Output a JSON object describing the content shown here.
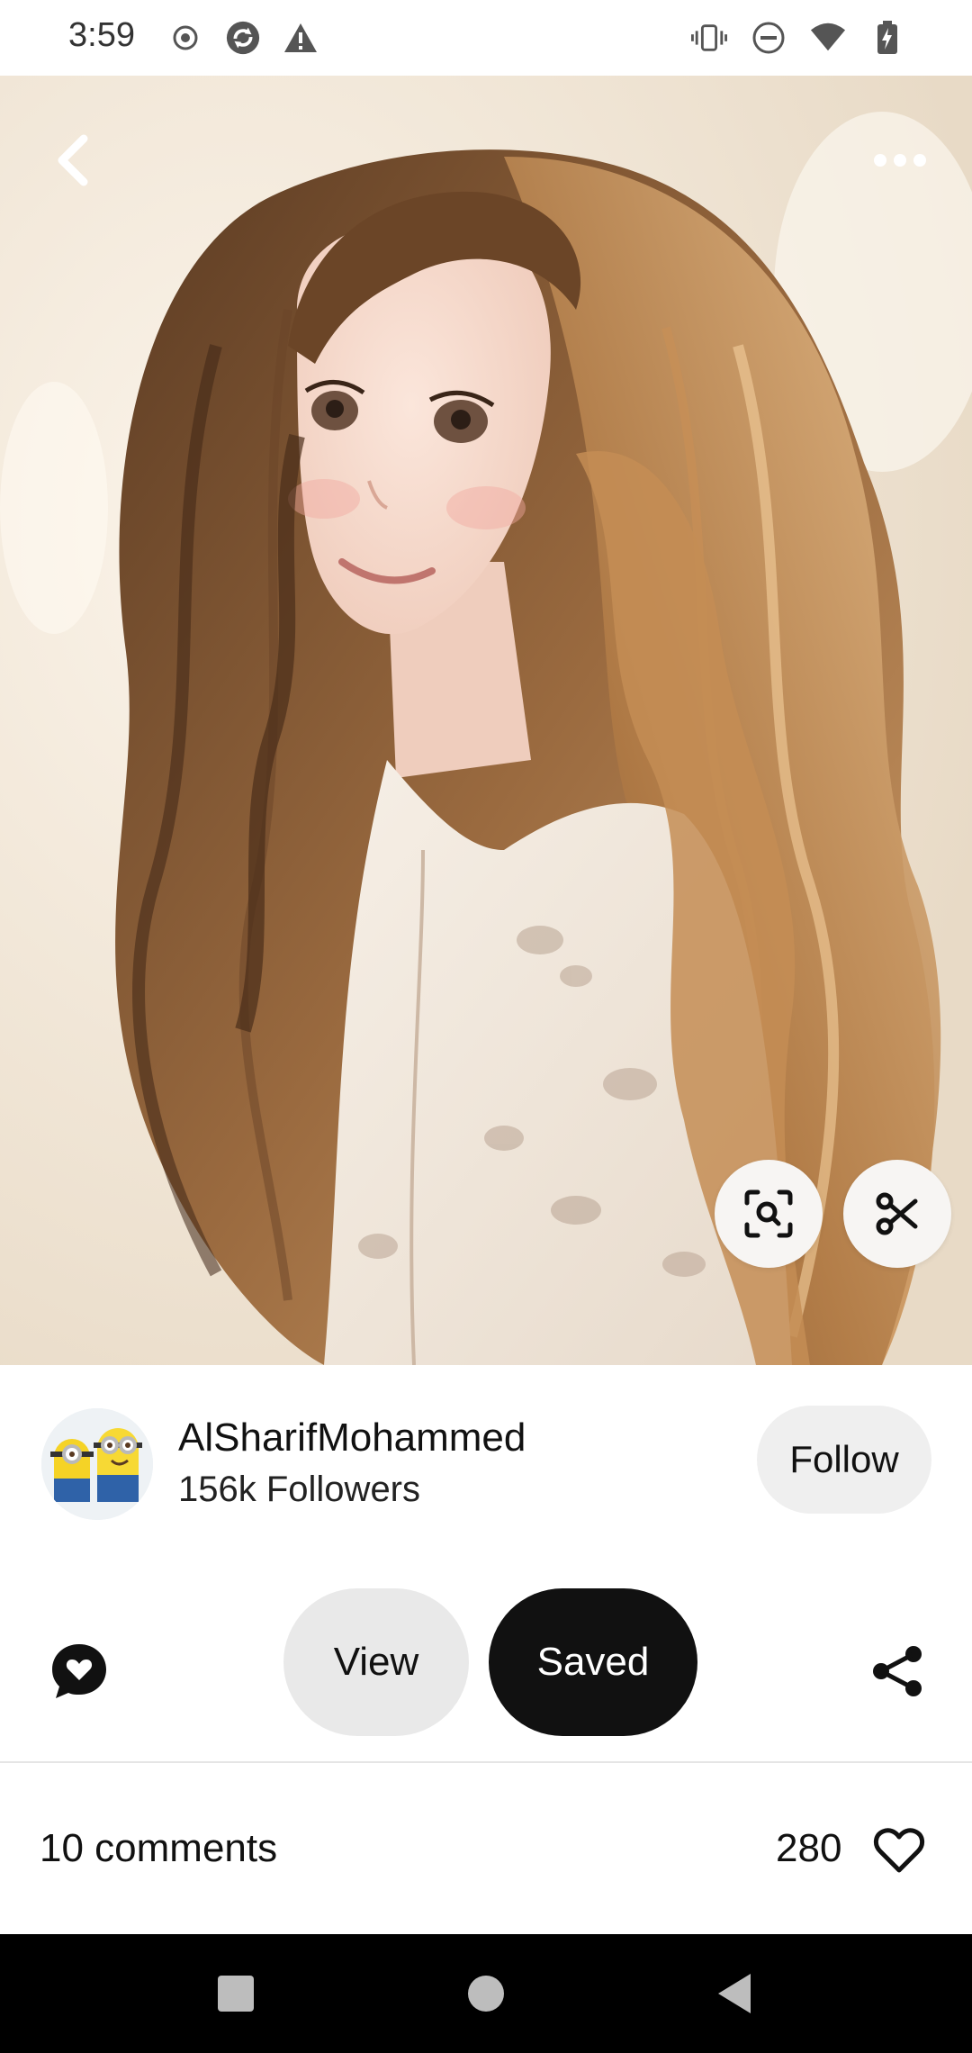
{
  "status_bar": {
    "time": "3:59",
    "left_icons": [
      "record-icon",
      "sync-icon",
      "warning-icon"
    ],
    "right_icons": [
      "vibrate-icon",
      "do-not-disturb-icon",
      "wifi-icon",
      "battery-charging-icon"
    ]
  },
  "hero": {
    "back_icon": "chevron-left-icon",
    "more_icon": "more-horizontal-icon",
    "lens_icon": "visual-search-icon",
    "cut_icon": "scissors-icon"
  },
  "creator": {
    "name": "AlSharifMohammed",
    "followers": "156k Followers",
    "follow_label": "Follow"
  },
  "actions": {
    "chat_icon": "chat-heart-icon",
    "view_label": "View",
    "saved_label": "Saved",
    "share_icon": "share-icon"
  },
  "engagement": {
    "comments": "10 comments",
    "likes": "280",
    "heart_icon": "heart-outline-icon"
  },
  "nav": {
    "icons": [
      "recents-icon",
      "home-icon",
      "back-icon"
    ]
  },
  "colors": {
    "primary_dark": "#111111",
    "pill_light": "#efefef",
    "nav_bg": "#000000"
  }
}
